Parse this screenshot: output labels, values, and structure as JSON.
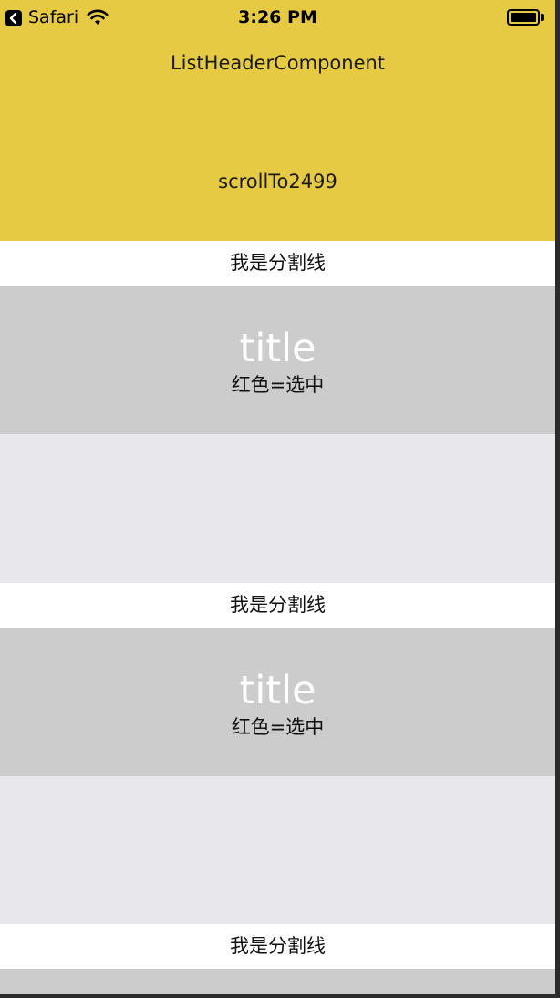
{
  "status_bar": {
    "carrier": "Safari",
    "time": "3:26 PM",
    "icons": [
      "back-arrow-icon",
      "wifi-icon",
      "battery-icon"
    ]
  },
  "header": {
    "title": "ListHeaderComponent",
    "scroll_button_label": "scrollTo2499",
    "background_color": "#e7ca43"
  },
  "list": {
    "divider_label": "我是分割线",
    "items": [
      {
        "title": "title",
        "subtitle": "红色=选中"
      },
      {
        "title": "title",
        "subtitle": "红色=选中"
      }
    ],
    "colors": {
      "item_background": "#cccccc",
      "gap_background": "#e8e7ec",
      "divider_background": "#ffffff"
    }
  }
}
